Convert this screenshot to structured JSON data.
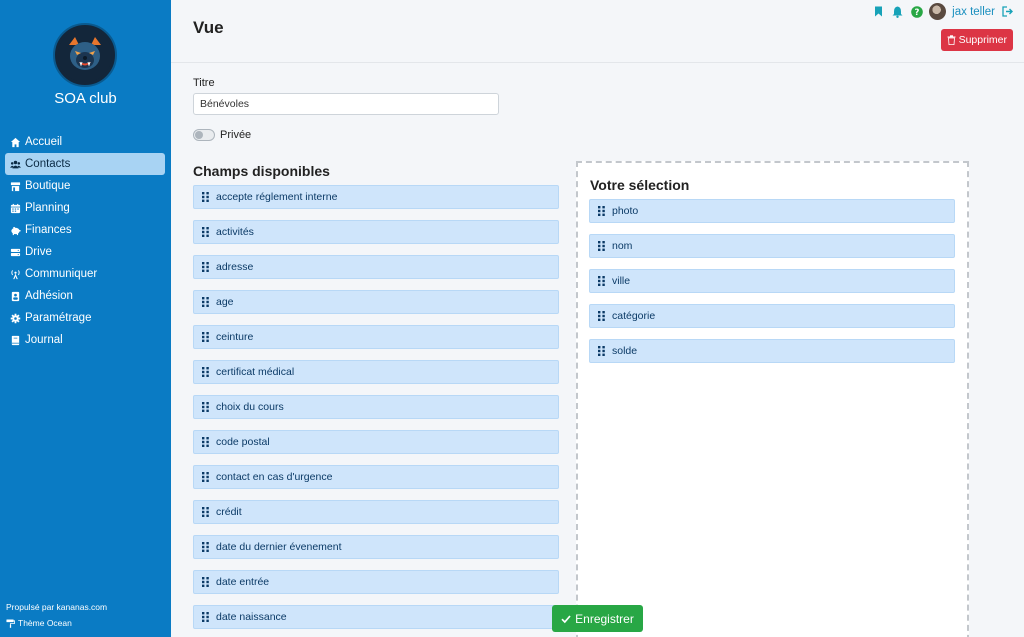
{
  "sidebar": {
    "club_name": "SOA club",
    "items": [
      {
        "label": "Accueil",
        "icon": "home-icon",
        "active": false
      },
      {
        "label": "Contacts",
        "icon": "users-icon",
        "active": true
      },
      {
        "label": "Boutique",
        "icon": "store-icon",
        "active": false
      },
      {
        "label": "Planning",
        "icon": "calendar-icon",
        "active": false
      },
      {
        "label": "Finances",
        "icon": "piggy-bank-icon",
        "active": false
      },
      {
        "label": "Drive",
        "icon": "drive-icon",
        "active": false
      },
      {
        "label": "Communiquer",
        "icon": "broadcast-icon",
        "active": false
      },
      {
        "label": "Adhésion",
        "icon": "id-card-icon",
        "active": false
      },
      {
        "label": "Paramétrage",
        "icon": "gear-icon",
        "active": false
      },
      {
        "label": "Journal",
        "icon": "book-icon",
        "active": false
      }
    ],
    "powered_by": "Propulsé par kananas.com",
    "theme": "Thème Ocean"
  },
  "header": {
    "title": "Vue",
    "user_name": "jax teller",
    "delete_label": "Supprimer"
  },
  "form": {
    "title_label": "Titre",
    "title_value": "Bénévoles",
    "private_label": "Privée"
  },
  "available": {
    "heading": "Champs disponibles",
    "fields": [
      "accepte réglement interne",
      "activités",
      "adresse",
      "age",
      "ceinture",
      "certificat médical",
      "choix du cours",
      "code postal",
      "contact en cas d'urgence",
      "crédit",
      "date du dernier évenement",
      "date entrée",
      "date naissance"
    ]
  },
  "selection": {
    "heading": "Votre sélection",
    "fields": [
      "photo",
      "nom",
      "ville",
      "catégorie",
      "solde"
    ]
  },
  "save_label": "Enregistrer",
  "colors": {
    "sidebar": "#0a7bc4",
    "field_bg": "#cfe5fb",
    "delete": "#dc3545",
    "save": "#28a745"
  }
}
